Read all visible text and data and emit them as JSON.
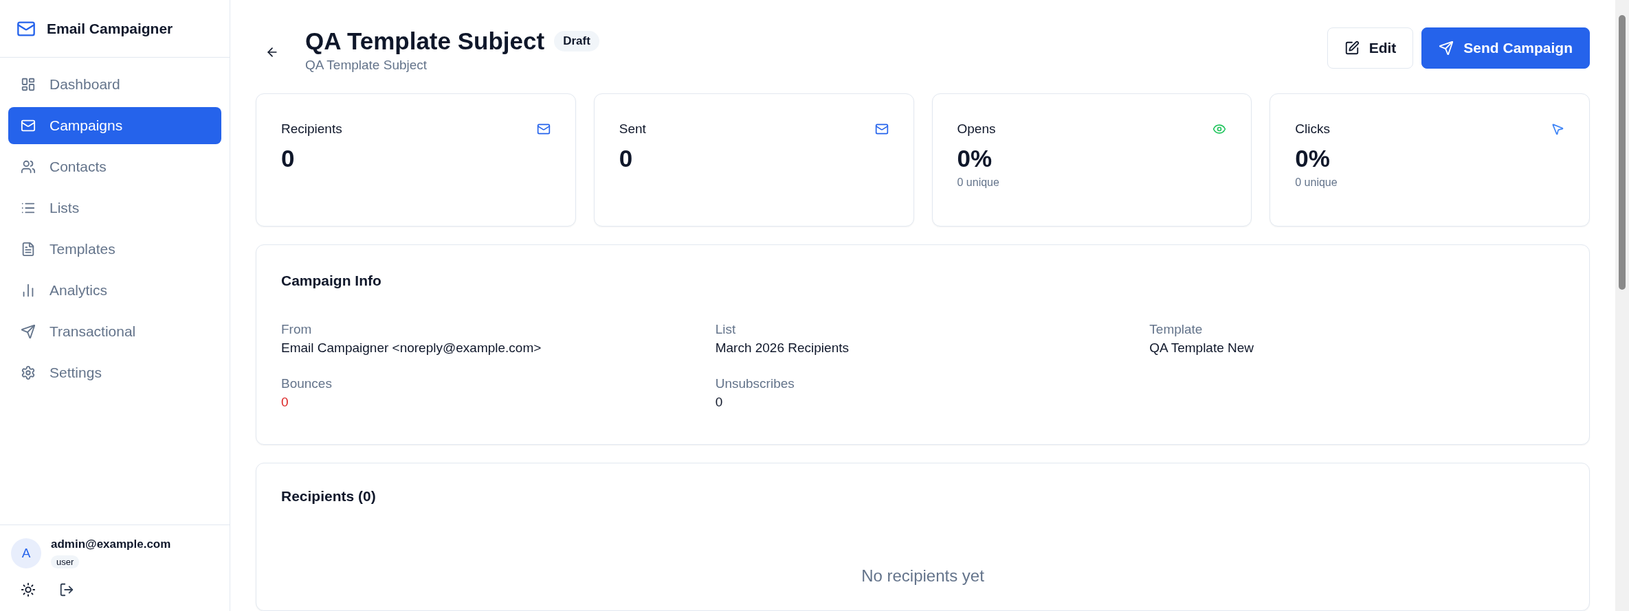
{
  "sidebar": {
    "app_name": "Email Campaigner",
    "items": [
      {
        "label": "Dashboard",
        "selected": false
      },
      {
        "label": "Campaigns",
        "selected": true
      },
      {
        "label": "Contacts",
        "selected": false
      },
      {
        "label": "Lists",
        "selected": false
      },
      {
        "label": "Templates",
        "selected": false
      },
      {
        "label": "Analytics",
        "selected": false
      },
      {
        "label": "Transactional",
        "selected": false
      },
      {
        "label": "Settings",
        "selected": false
      }
    ],
    "user": {
      "avatar": "A",
      "email": "admin@example.com",
      "role": "user"
    }
  },
  "header": {
    "title": "QA Template Subject",
    "status": "Draft",
    "subtitle": "QA Template Subject",
    "buttons": [
      {
        "label": "Edit",
        "kind": "outline"
      },
      {
        "label": "Send Campaign",
        "kind": "primary"
      }
    ]
  },
  "stats": [
    {
      "label": "Recipients",
      "value": "0"
    },
    {
      "label": "Sent",
      "value": "0"
    },
    {
      "label": "Opens",
      "value": "0%",
      "note": "0 unique"
    },
    {
      "label": "Clicks",
      "value": "0%",
      "note": "0 unique"
    }
  ],
  "campaign_info": {
    "title": "Campaign Info",
    "fields": [
      {
        "label": "From",
        "value": "Email Campaigner <noreply@example.com>",
        "kind": "plain"
      },
      {
        "label": "List",
        "value": "March 2026 Recipients",
        "kind": "plain"
      },
      {
        "label": "Template",
        "value": "QA Template New",
        "kind": "plain"
      },
      {
        "label": "Bounces",
        "value": "0",
        "kind": "alert"
      },
      {
        "label": "Unsubscribes",
        "value": "0",
        "kind": "plain"
      }
    ]
  },
  "recipients": {
    "title": "Recipients (0)",
    "empty_text": "No recipients yet"
  }
}
